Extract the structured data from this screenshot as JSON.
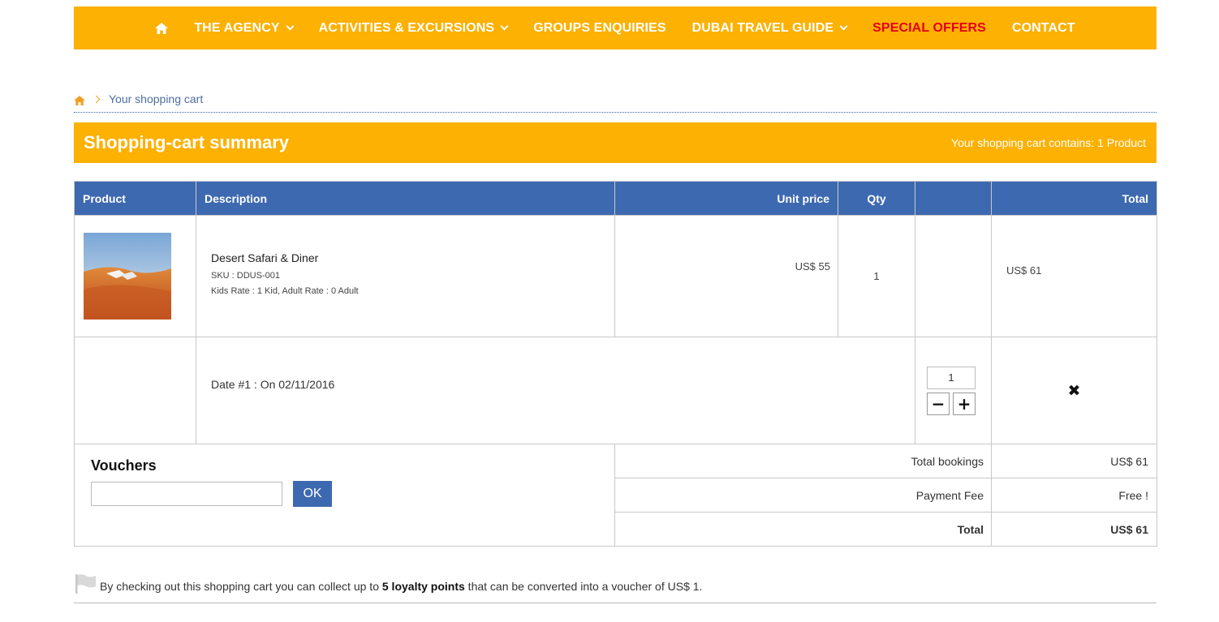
{
  "nav": {
    "items": [
      {
        "label": "THE AGENCY",
        "dropdown": true
      },
      {
        "label": "ACTIVITIES & EXCURSIONS",
        "dropdown": true
      },
      {
        "label": "GROUPS ENQUIRIES",
        "dropdown": false
      },
      {
        "label": "DUBAI TRAVEL GUIDE",
        "dropdown": true
      },
      {
        "label": "SPECIAL OFFERS",
        "dropdown": false
      },
      {
        "label": "CONTACT",
        "dropdown": false
      }
    ],
    "background": "#fcb103",
    "special_color": "#e4001b"
  },
  "breadcrumb": {
    "current": "Your shopping cart"
  },
  "summary": {
    "title": "Shopping-cart summary",
    "count_text": "Your shopping cart contains: 1 Product"
  },
  "table": {
    "headers": {
      "product": "Product",
      "description": "Description",
      "unit_price": "Unit price",
      "qty": "Qty",
      "total": "Total"
    },
    "item": {
      "name": "Desert Safari & Diner",
      "sku": "SKU : DDUS-001",
      "rates": "Kids Rate : 1 Kid, Adult Rate : 0 Adult",
      "unit_price": "US$ 55",
      "qty": "1",
      "total": "US$ 61",
      "date": "Date #1 : On 02/11/2016",
      "qty_input": "1"
    },
    "header_color": "#3d69b0"
  },
  "vouchers": {
    "title": "Vouchers",
    "ok_label": "OK",
    "input_value": ""
  },
  "totals": {
    "bookings_label": "Total bookings",
    "bookings_value": "US$ 61",
    "fee_label": "Payment Fee",
    "fee_value": "Free !",
    "total_label": "Total",
    "total_value": "US$ 61"
  },
  "loyalty": {
    "prefix": "By checking out this shopping cart you can collect up to ",
    "points": "5 loyalty points",
    "suffix": " that can be converted into a voucher of US$ 1."
  }
}
